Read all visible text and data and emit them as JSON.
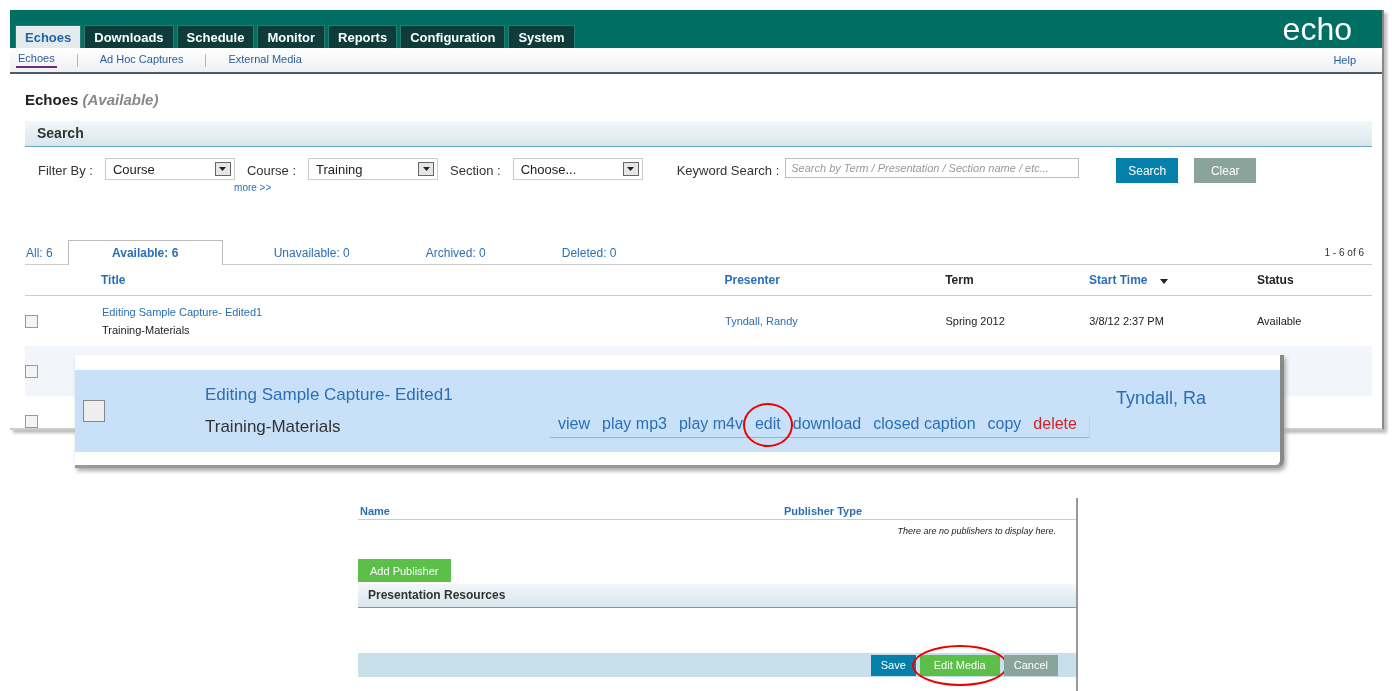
{
  "app": {
    "logo": "echo",
    "tabs": [
      {
        "label": "Echoes",
        "selected": true
      },
      {
        "label": "Downloads",
        "selected": false
      },
      {
        "label": "Schedule",
        "selected": false
      },
      {
        "label": "Monitor",
        "selected": false
      },
      {
        "label": "Reports",
        "selected": false
      },
      {
        "label": "Configuration",
        "selected": false
      },
      {
        "label": "System",
        "selected": false
      }
    ],
    "subnav": [
      {
        "label": "Echoes",
        "selected": true
      },
      {
        "label": "Ad Hoc Captures",
        "selected": false
      },
      {
        "label": "External Media",
        "selected": false
      }
    ],
    "help": "Help"
  },
  "page": {
    "title": "Echoes",
    "status": "(Available)"
  },
  "search": {
    "heading": "Search",
    "filters": [
      {
        "label": "Filter By :",
        "value": "Course"
      },
      {
        "label": "Course :",
        "value": "Training"
      },
      {
        "label": "Section :",
        "value": "Choose..."
      }
    ],
    "more": "more >>",
    "keyword_label": "Keyword Search :",
    "keyword_placeholder": "Search by Term / Presentation / Section name / etc...",
    "buttons": [
      {
        "label": "Search",
        "kind": "primary"
      },
      {
        "label": "Clear",
        "kind": "secondary"
      }
    ]
  },
  "status_tabs": [
    {
      "label": "All: 6",
      "selected": false
    },
    {
      "label": "Available: 6",
      "selected": true
    },
    {
      "label": "Unavailable: 0",
      "selected": false
    },
    {
      "label": "Archived: 0",
      "selected": false
    },
    {
      "label": "Deleted: 0",
      "selected": false
    }
  ],
  "pagination": "1 - 6  of  6",
  "table": {
    "columns": [
      {
        "label": "Title",
        "sortable": true,
        "sort_arrow": false
      },
      {
        "label": "Presenter",
        "sortable": true,
        "sort_arrow": false
      },
      {
        "label": "Term",
        "sortable": false,
        "sort_arrow": false
      },
      {
        "label": "Start Time",
        "sortable": true,
        "sort_arrow": true
      },
      {
        "label": "Status",
        "sortable": false,
        "sort_arrow": false
      }
    ],
    "rows": [
      {
        "checked": false,
        "title": "Editing Sample Capture- Edited1",
        "subtitle": "Training-Materials",
        "presenter": "Tyndall, Randy",
        "term": "Spring 2012",
        "start_time": "3/8/12 2:37 PM",
        "status": "Available"
      },
      {
        "checked": false
      },
      {
        "checked": false
      }
    ]
  },
  "zoomed_row": {
    "checked": false,
    "title": "Editing Sample Capture- Edited1",
    "subtitle": "Training-Materials",
    "presenter": "Tyndall, Ra",
    "actions": [
      {
        "label": "view",
        "kind": "link",
        "circled": false
      },
      {
        "label": "play mp3",
        "kind": "link",
        "circled": false
      },
      {
        "label": "play m4v",
        "kind": "link",
        "circled": false
      },
      {
        "label": "edit",
        "kind": "link",
        "circled": true
      },
      {
        "label": "download",
        "kind": "link",
        "circled": false
      },
      {
        "label": "closed caption",
        "kind": "link",
        "circled": false
      },
      {
        "label": "copy",
        "kind": "link",
        "circled": false
      },
      {
        "label": "delete",
        "kind": "danger",
        "circled": false
      }
    ]
  },
  "edit_panel": {
    "columns": [
      "Name",
      "Publisher Type"
    ],
    "empty_message": "There are no publishers to display here.",
    "add_button": "Add Publisher",
    "resources_heading": "Presentation Resources",
    "buttons": [
      {
        "label": "Save",
        "kind": "primary",
        "circled": false
      },
      {
        "label": "Edit Media",
        "kind": "success",
        "circled": true
      },
      {
        "label": "Cancel",
        "kind": "secondary",
        "circled": false
      }
    ]
  }
}
